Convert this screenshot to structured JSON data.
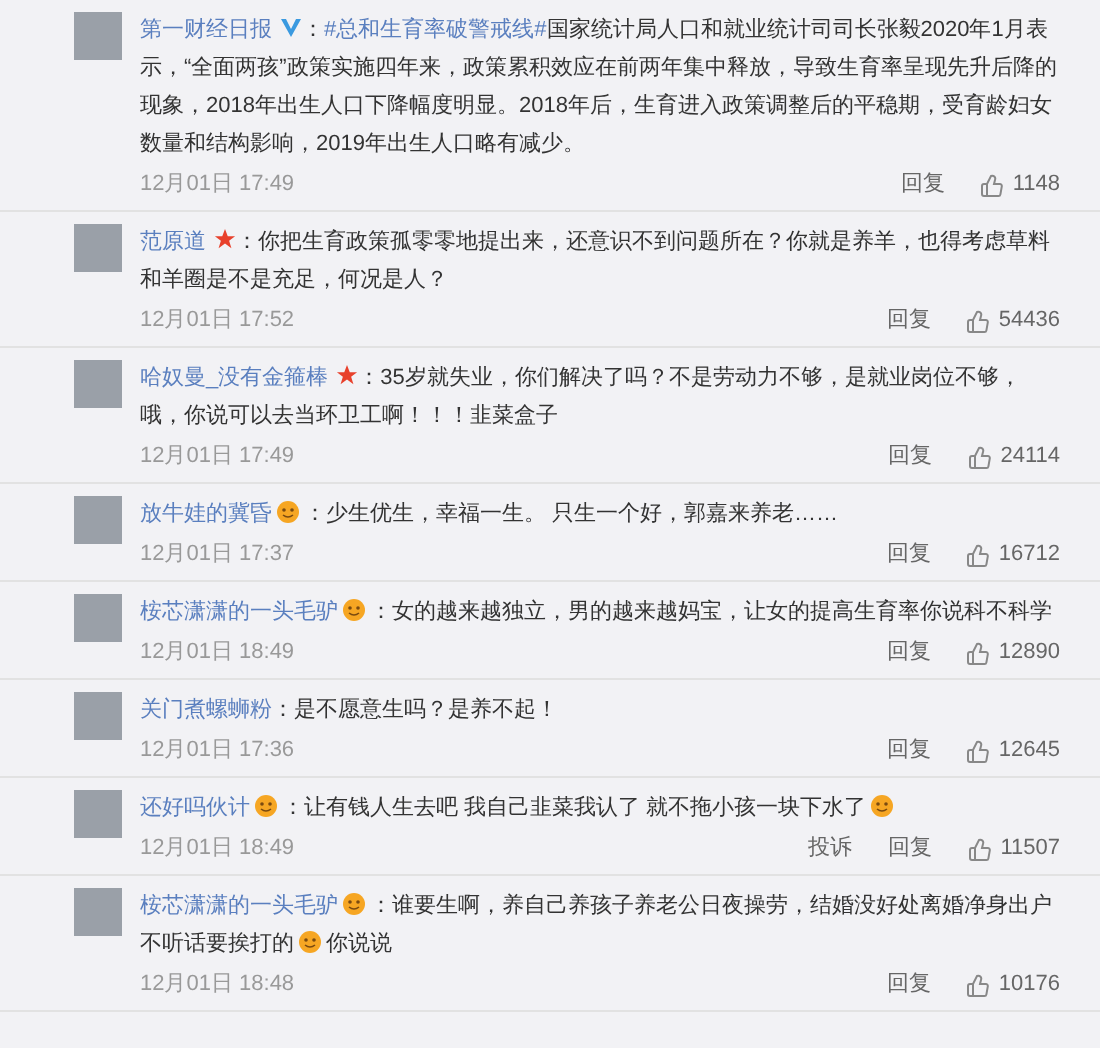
{
  "comments": [
    {
      "name": "第一财经日报",
      "badge": {
        "kind": "verified"
      },
      "separator": "：",
      "segments": [
        {
          "kind": "link",
          "text": "#总和生育率破警戒线#"
        },
        {
          "kind": "text",
          "text": "国家统计局人口和就业统计司司长张毅2020年1月表示，“全面两孩”政策实施四年来，政策累积效应在前两年集中释放，导致生育率呈现先升后降的现象，2018年出生人口下降幅度明显。2018年后，生育进入政策调整后的平稳期，受育龄妇女数量和结构影响，2019年出生人口略有减少。"
        }
      ],
      "date": "12月01日 17:49",
      "actions": [
        "回复"
      ],
      "likes": "1148"
    },
    {
      "name": "范原道",
      "badge": {
        "kind": "star"
      },
      "separator": "：",
      "segments": [
        {
          "kind": "text",
          "text": "你把生育政策孤零零地提出来，还意识不到问题所在？你就是养羊，也得考虑草料和羊圈是不是充足，何况是人？"
        }
      ],
      "date": "12月01日 17:52",
      "actions": [
        "回复"
      ],
      "likes": "54436"
    },
    {
      "name": "哈奴曼_没有金箍棒",
      "badge": {
        "kind": "star"
      },
      "separator": "：",
      "segments": [
        {
          "kind": "text",
          "text": "35岁就失业，你们解决了吗？不是劳动力不够，是就业岗位不够，哦，你说可以去当环卫工啊！！！韭菜盒子"
        }
      ],
      "date": "12月01日 17:49",
      "actions": [
        "回复"
      ],
      "likes": "24114"
    },
    {
      "name": "放牛娃的冀昏",
      "badge": {
        "kind": "emoji"
      },
      "separator": "：",
      "segments": [
        {
          "kind": "text",
          "text": "少生优生，幸福一生。 只生一个好，郭嘉来养老……"
        }
      ],
      "date": "12月01日 17:37",
      "actions": [
        "回复"
      ],
      "likes": "16712"
    },
    {
      "name": "桉芯潇潇的一头毛驴",
      "badge": {
        "kind": "emoji"
      },
      "separator": "：",
      "segments": [
        {
          "kind": "text",
          "text": "女的越来越独立，男的越来越妈宝，让女的提高生育率你说科不科学"
        }
      ],
      "date": "12月01日 18:49",
      "actions": [
        "回复"
      ],
      "likes": "12890"
    },
    {
      "name": "关门煮螺蛳粉",
      "separator": "：",
      "segments": [
        {
          "kind": "text",
          "text": "是不愿意生吗？是养不起！"
        }
      ],
      "date": "12月01日 17:36",
      "actions": [
        "回复"
      ],
      "likes": "12645"
    },
    {
      "name": "还好吗伙计",
      "badge": {
        "kind": "emoji"
      },
      "separator": "：",
      "segments": [
        {
          "kind": "text",
          "text": "让有钱人生去吧 我自己韭菜我认了 就不拖小孩一块下水了"
        },
        {
          "kind": "emoji"
        }
      ],
      "date": "12月01日 18:49",
      "actions": [
        "投诉",
        "回复"
      ],
      "likes": "11507"
    },
    {
      "name": "桉芯潇潇的一头毛驴",
      "badge": {
        "kind": "emoji"
      },
      "separator": "：",
      "segments": [
        {
          "kind": "text",
          "text": "谁要生啊，养自己养孩子养老公日夜操劳，结婚没好处离婚净身出户不听话要挨打的"
        },
        {
          "kind": "emoji"
        },
        {
          "kind": "text",
          "text": "你说说"
        }
      ],
      "date": "12月01日 18:48",
      "actions": [
        "回复"
      ],
      "likes": "10176"
    }
  ]
}
